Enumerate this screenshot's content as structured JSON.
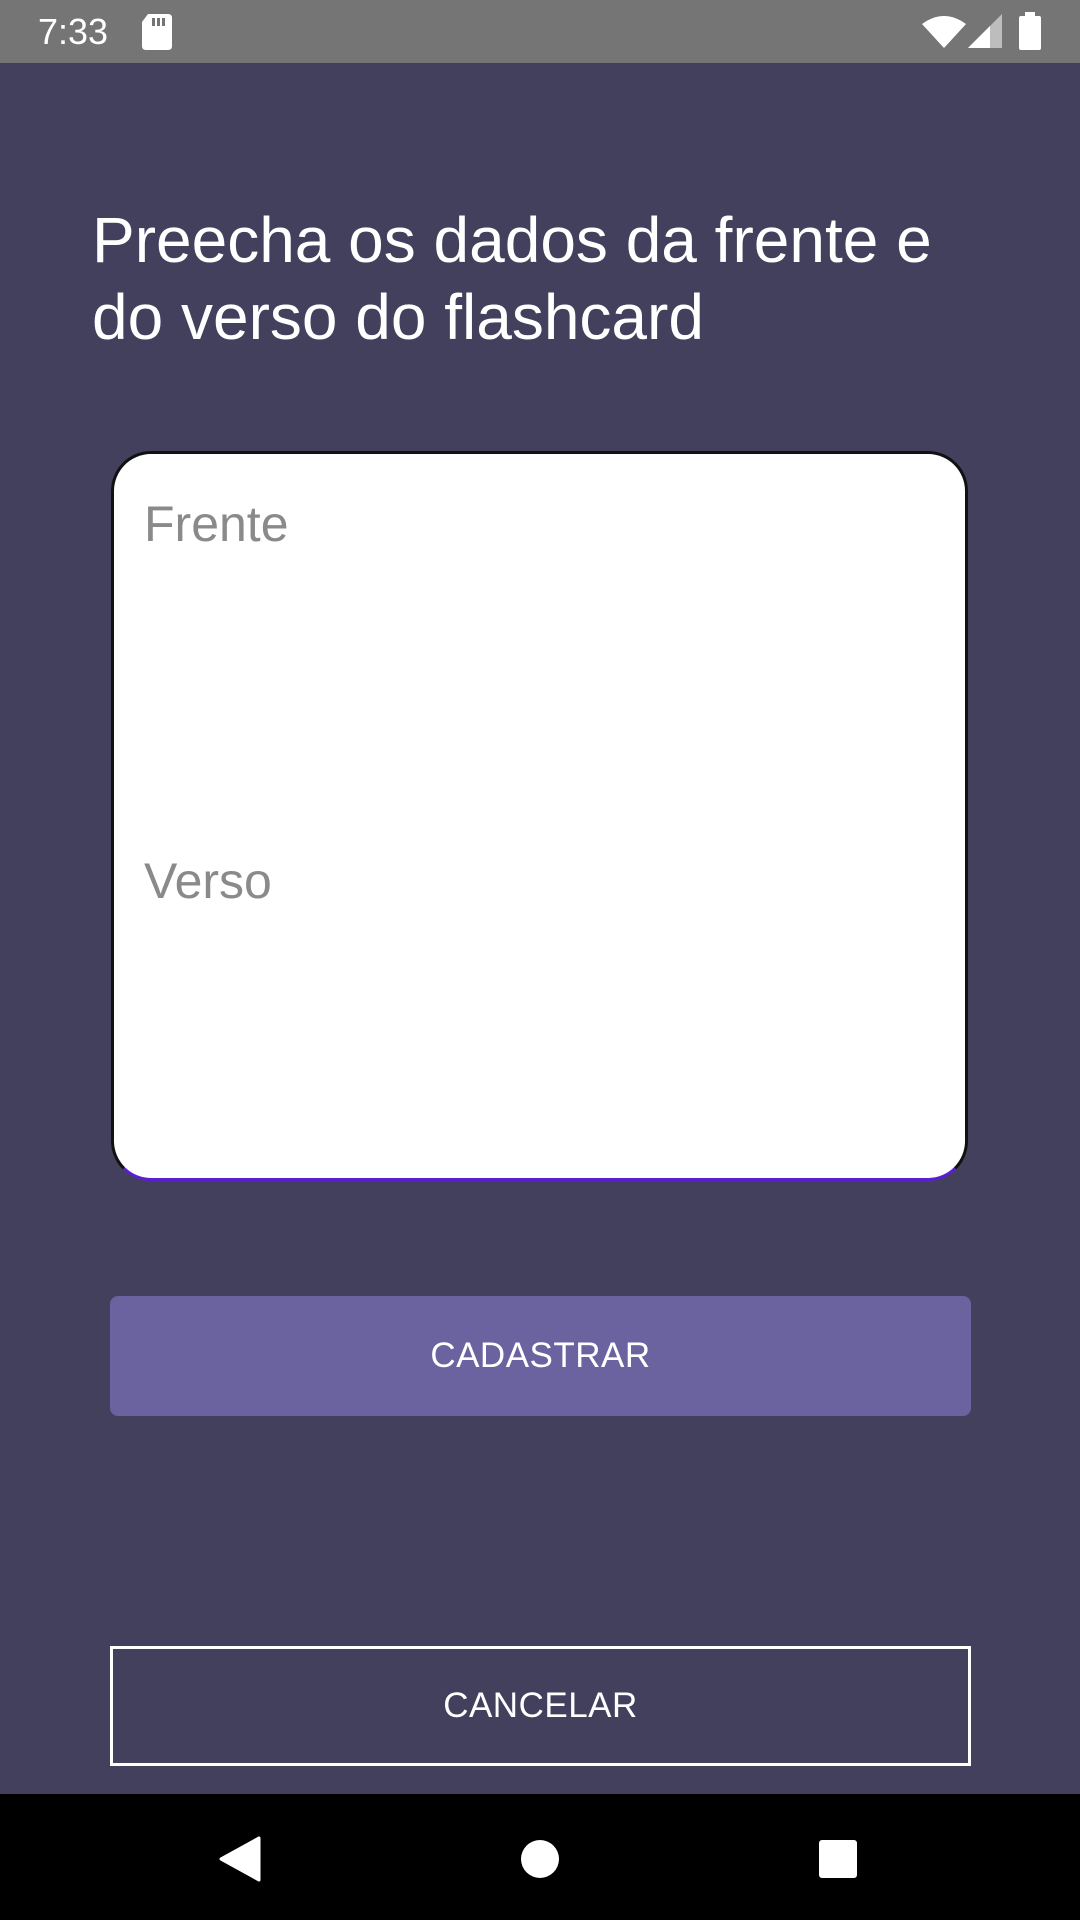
{
  "status_bar": {
    "time": "7:33",
    "icons": [
      "sd-card-icon",
      "wifi-icon",
      "signal-icon",
      "battery-icon"
    ]
  },
  "form": {
    "title": "Preecha os dados da frente e do verso do flashcard",
    "front_placeholder": "Frente",
    "back_placeholder": "Verso",
    "front_value": "",
    "back_value": ""
  },
  "actions": {
    "register_label": "CADASTRAR",
    "cancel_label": "CANCELAR"
  },
  "nav_bar": {
    "icons": [
      "back-icon",
      "home-icon",
      "recents-icon"
    ]
  },
  "colors": {
    "background": "#42405c",
    "status_bar": "#757575",
    "primary_button": "#6b62a0",
    "card": "#ffffff",
    "accent_underline": "#5a1fd1"
  }
}
